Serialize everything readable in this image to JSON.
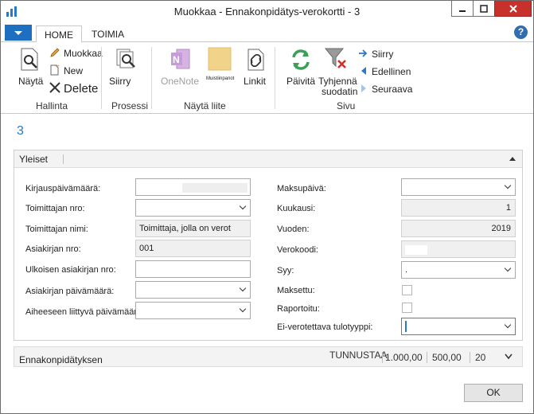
{
  "window": {
    "title": "Muokkaa - Ennakonpidätys-verokortti - 3"
  },
  "tabs": {
    "home": "HOME",
    "toimia": "TOIMIA",
    "help": "?"
  },
  "ribbon": {
    "nayta": "Näytä",
    "muokkaa": "Muokkaa",
    "new": "New",
    "delete": "Delete",
    "hallinta": "Hallinta",
    "siirry_action": "Siirry",
    "prosessi": "Prosessi",
    "onenote": "OneNote",
    "muistiinpanot": "Muistiinpanot",
    "linkit": "Linkit",
    "nayta_liite": "Näytä liite",
    "paivita": "Päivitä",
    "tyhjenna": "Tyhjennä",
    "suodatin": "suodatin",
    "siirry_nav": "Siirry",
    "edellinen": "Edellinen",
    "seuraava": "Seuraava",
    "sivu": "Sivu"
  },
  "record": {
    "number": "3"
  },
  "yleiset": {
    "title": "Yleiset",
    "left": {
      "kirjauspvm_label": "Kirjauspäivämäärä:",
      "toimittajan_nro_label": "Toimittajan nro:",
      "toimittajan_nimi_label": "Toimittajan nimi:",
      "toimittajan_nimi_value": "Toimittaja, jolla on verot",
      "asiakirjan_nro_label": "Asiakirjan nro:",
      "asiakirjan_nro_value": "001",
      "ulkoisen_label": "Ulkoisen asiakirjan nro:",
      "asiakirjan_pvm_label": "Asiakirjan päivämäärä:",
      "aiheeseen_label": "Aiheeseen liittyvä päivämäärä:"
    },
    "right": {
      "maksupaiva_label": "Maksupäivä:",
      "kuukausi_label": "Kuukausi:",
      "kuukausi_value": "1",
      "vuoden_label": "Vuoden:",
      "vuoden_value": "2019",
      "verokoodi_label": "Verokoodi:",
      "syy_label": "Syy:",
      "syy_value": ".",
      "maksettu_label": "Maksettu:",
      "raportoitu_label": "Raportoitu:",
      "ei_verotettava_label": "Ei-verotettava tulotyyppi:"
    }
  },
  "ennakonpidatyksen": {
    "title": "Ennakonpidätyksen",
    "tunnustaa": "TUNNUSTAA",
    "amount1": "1.000,00",
    "amount2": "500,00",
    "percent": "20"
  },
  "footer": {
    "ok": "OK"
  }
}
